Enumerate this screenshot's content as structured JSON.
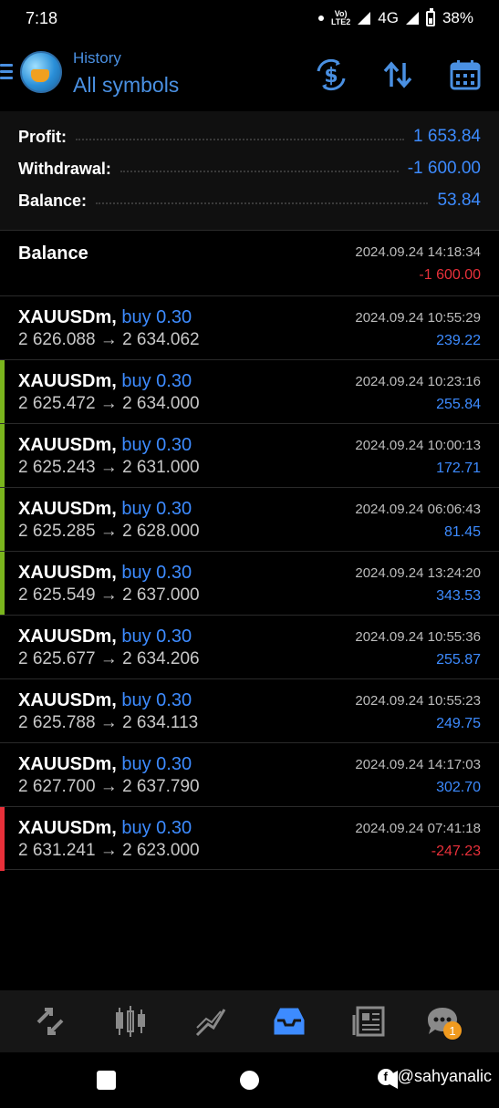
{
  "status": {
    "time": "7:18",
    "volte_top": "Vo)",
    "volte_bottom": "LTE2",
    "network": "4G",
    "battery": "38%"
  },
  "header": {
    "subtitle": "History",
    "title": "All symbols",
    "icons": [
      "currency-exchange-icon",
      "sort-icon",
      "calendar-icon"
    ]
  },
  "summary": {
    "profit_label": "Profit:",
    "profit_value": "1 653.84",
    "withdrawal_label": "Withdrawal:",
    "withdrawal_value": "-1 600.00",
    "balance_label": "Balance:",
    "balance_value": "53.84"
  },
  "balance_entry": {
    "title": "Balance",
    "time": "2024.09.24 14:18:34",
    "amount": "-1 600.00"
  },
  "trades": [
    {
      "symbol": "XAUUSDm,",
      "type": "buy 0.30",
      "prices": "2 626.088 → 2 634.062",
      "time": "2024.09.24 10:55:29",
      "profit": "239.22",
      "indicator": "none"
    },
    {
      "symbol": "XAUUSDm,",
      "type": "buy 0.30",
      "prices": "2 625.472 → 2 634.000",
      "time": "2024.09.24 10:23:16",
      "profit": "255.84",
      "indicator": "green"
    },
    {
      "symbol": "XAUUSDm,",
      "type": "buy 0.30",
      "prices": "2 625.243 → 2 631.000",
      "time": "2024.09.24 10:00:13",
      "profit": "172.71",
      "indicator": "green"
    },
    {
      "symbol": "XAUUSDm,",
      "type": "buy 0.30",
      "prices": "2 625.285 → 2 628.000",
      "time": "2024.09.24 06:06:43",
      "profit": "81.45",
      "indicator": "green"
    },
    {
      "symbol": "XAUUSDm,",
      "type": "buy 0.30",
      "prices": "2 625.549 → 2 637.000",
      "time": "2024.09.24 13:24:20",
      "profit": "343.53",
      "indicator": "green"
    },
    {
      "symbol": "XAUUSDm,",
      "type": "buy 0.30",
      "prices": "2 625.677 → 2 634.206",
      "time": "2024.09.24 10:55:36",
      "profit": "255.87",
      "indicator": "none"
    },
    {
      "symbol": "XAUUSDm,",
      "type": "buy 0.30",
      "prices": "2 625.788 → 2 634.113",
      "time": "2024.09.24 10:55:23",
      "profit": "249.75",
      "indicator": "none"
    },
    {
      "symbol": "XAUUSDm,",
      "type": "buy 0.30",
      "prices": "2 627.700 → 2 637.790",
      "time": "2024.09.24 14:17:03",
      "profit": "302.70",
      "indicator": "none"
    },
    {
      "symbol": "XAUUSDm,",
      "type": "buy 0.30",
      "prices": "2 631.241 → 2 623.000",
      "time": "2024.09.24 07:41:18",
      "profit": "-247.23",
      "indicator": "red"
    }
  ],
  "colors": {
    "accent_blue": "#3d8bff",
    "header_blue": "#4a90e2",
    "loss_red": "#e8303a",
    "win_green": "#7ab51d",
    "orange_badge": "#f09a1e"
  },
  "bottom_nav": {
    "items": [
      "quotes-icon",
      "chart-candles-icon",
      "trade-icon",
      "history-inbox-icon",
      "news-icon",
      "chat-icon"
    ],
    "active_index": 3,
    "chat_badge": "1"
  },
  "watermark": {
    "text": "@sahyanalic"
  }
}
